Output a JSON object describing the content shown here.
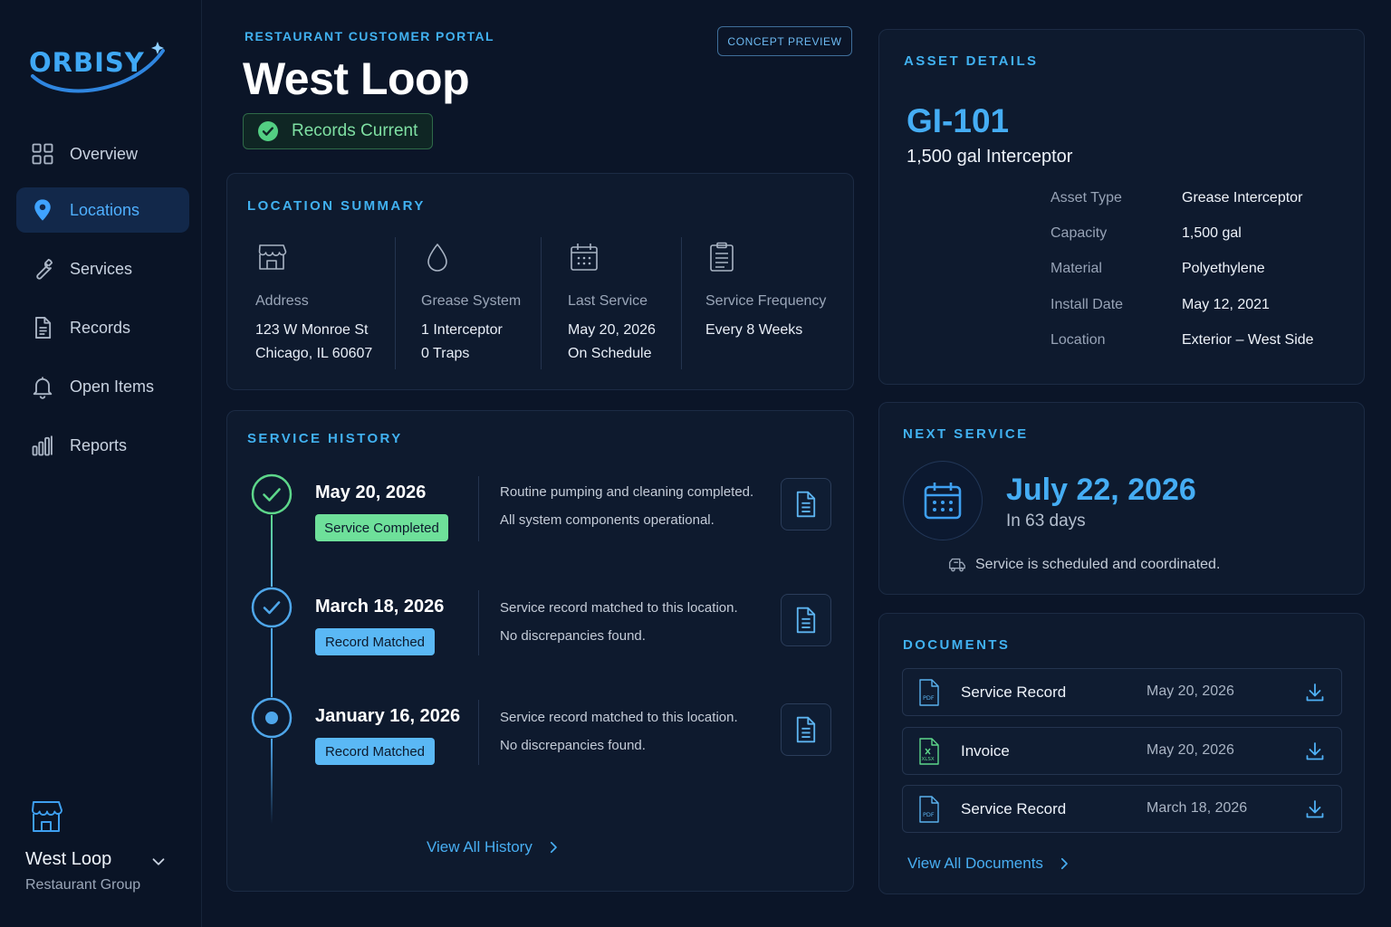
{
  "brand": {
    "name": "ORBISY",
    "accent": "#41b1f0",
    "background": "#0b1528"
  },
  "sidebar": {
    "items": [
      {
        "label": "Overview",
        "icon": "grid-icon",
        "active": false
      },
      {
        "label": "Locations",
        "icon": "map-pin-icon",
        "active": true
      },
      {
        "label": "Services",
        "icon": "wrench-icon",
        "active": false
      },
      {
        "label": "Records",
        "icon": "document-icon",
        "active": false
      },
      {
        "label": "Open Items",
        "icon": "bell-icon",
        "active": false
      },
      {
        "label": "Reports",
        "icon": "bar-chart-icon",
        "active": false
      }
    ],
    "location_switcher": {
      "name": "West Loop",
      "group": "Restaurant Group",
      "icon": "storefront-icon"
    }
  },
  "header": {
    "eyebrow": "RESTAURANT CUSTOMER PORTAL",
    "title": "West Loop",
    "status": {
      "label": "Records Current",
      "color": "#7fe0a3"
    },
    "concept_badge": "CONCEPT PREVIEW"
  },
  "summary": {
    "title": "LOCATION SUMMARY",
    "columns": [
      {
        "icon": "storefront-icon",
        "label": "Address",
        "line1": "123 W Monroe St",
        "line2": "Chicago, IL 60607"
      },
      {
        "icon": "droplet-icon",
        "label": "Grease System",
        "line1": "1 Interceptor",
        "line2": "0 Traps"
      },
      {
        "icon": "calendar-icon",
        "label": "Last Service",
        "line1": "May 20, 2026",
        "line2": "On Schedule"
      },
      {
        "icon": "clipboard-icon",
        "label": "Service Frequency",
        "line1": "Every 8 Weeks",
        "line2": ""
      }
    ]
  },
  "history": {
    "title": "SERVICE HISTORY",
    "entries": [
      {
        "date": "May 20, 2026",
        "badge": "Service Completed",
        "badge_color": "#6ee09a",
        "line1": "Routine pumping and cleaning completed.",
        "line2": "All system components operational.",
        "node": "check-green"
      },
      {
        "date": "March 18, 2026",
        "badge": "Record Matched",
        "badge_color": "#5ab8f5",
        "line1": "Service record matched to this location.",
        "line2": "No discrepancies found.",
        "node": "check-blue"
      },
      {
        "date": "January 16, 2026",
        "badge": "Record Matched",
        "badge_color": "#5ab8f5",
        "line1": "Service record matched to this location.",
        "line2": "No discrepancies found.",
        "node": "dot-blue"
      }
    ],
    "view_all": "View All History"
  },
  "asset": {
    "title": "ASSET DETAILS",
    "id": "GI-101",
    "description": "1,500 gal Interceptor",
    "fields": [
      {
        "key": "Asset Type",
        "value": "Grease Interceptor"
      },
      {
        "key": "Capacity",
        "value": "1,500 gal"
      },
      {
        "key": "Material",
        "value": "Polyethylene"
      },
      {
        "key": "Install Date",
        "value": "May 12, 2021"
      },
      {
        "key": "Location",
        "value": "Exterior – West Side"
      }
    ]
  },
  "next_service": {
    "title": "NEXT SERVICE",
    "date": "July 22, 2026",
    "in_days": "In 63 days",
    "note": "Service is scheduled and coordinated."
  },
  "documents": {
    "title": "DOCUMENTS",
    "items": [
      {
        "name": "Service Record",
        "date": "May 20, 2026",
        "type": "PDF"
      },
      {
        "name": "Invoice",
        "date": "May 20, 2026",
        "type": "XLSX"
      },
      {
        "name": "Service Record",
        "date": "March 18, 2026",
        "type": "PDF"
      }
    ],
    "view_all": "View All Documents"
  }
}
